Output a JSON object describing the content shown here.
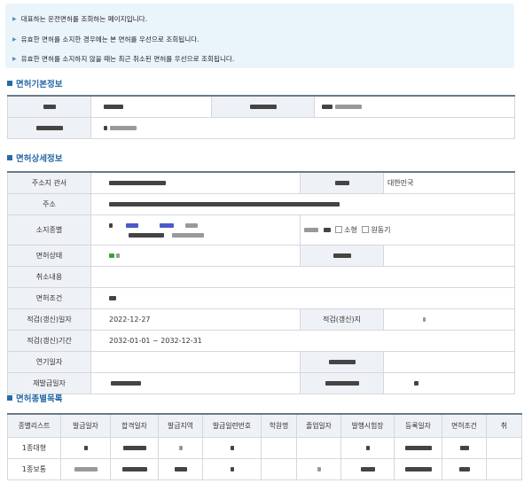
{
  "notices": [
    "대표하는 운전면허를 조회하는 페이지입니다.",
    "유효한 면허를 소지한 경우에는 본 면허를 우선으로 조회됩니다.",
    "유효한 면허를 소지하지 않을 때는 최근 취소된 면허를 우선으로 조회됩니다."
  ],
  "basic": {
    "title": "면허기본정보"
  },
  "detail": {
    "title": "면허상세정보",
    "labels": {
      "address_office": "주소지 관서",
      "address": "주소",
      "license_type": "소지종별",
      "status": "면허상태",
      "cancel": "취소내용",
      "conditions": "면허조건",
      "renewal_date": "적검(갱신)일자",
      "renewal_place": "적검(갱신)지",
      "renewal_period": "적검(갱신)기간",
      "extension": "연기일자",
      "reissue": "재발급일자"
    },
    "country": "대한민국",
    "checkbox_small": "소형",
    "checkbox_moped": "원동기",
    "renewal_date_value": "2022-12-27",
    "renewal_period_value": "2032-01-01 ~ 2032-12-31"
  },
  "list": {
    "title": "면허종별목록",
    "headers": [
      "종별리스트",
      "발급일자",
      "합격일자",
      "발급지역",
      "발급일련번호",
      "학원명",
      "졸업일자",
      "발행시험장",
      "등록일자",
      "면허조건",
      "취"
    ],
    "rows": [
      {
        "type": "1종대형"
      },
      {
        "type": "1종보통"
      }
    ]
  }
}
